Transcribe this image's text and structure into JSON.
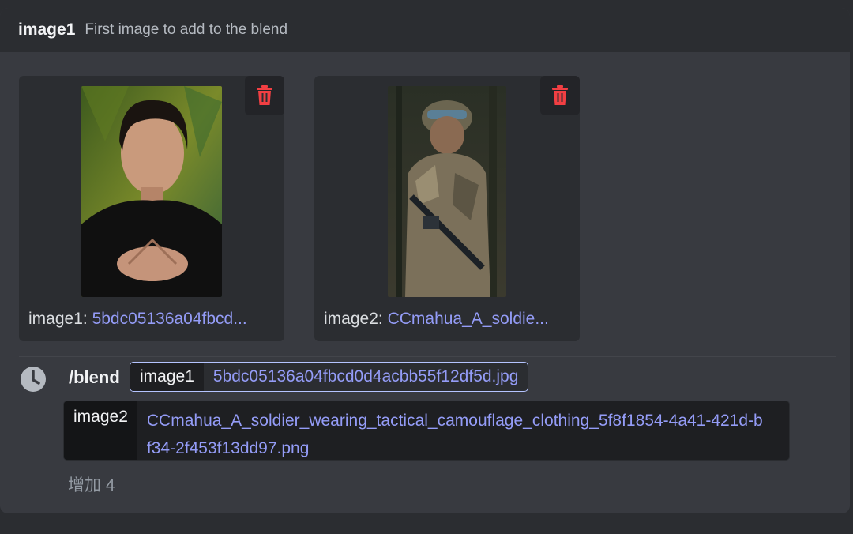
{
  "hint": {
    "name": "image1",
    "description": "First image to add to the blend"
  },
  "attachments": [
    {
      "key": "image1:",
      "value": "5bdc05136a04fbcd..."
    },
    {
      "key": "image2:",
      "value": "CCmahua_A_soldie..."
    }
  ],
  "command": {
    "name": "/blend",
    "options": [
      {
        "key": "image1",
        "value": "5bdc05136a04fbcd0d4acbb55f12df5d.jpg"
      },
      {
        "key": "image2",
        "value": "CCmahua_A_soldier_wearing_tactical_camouflage_clothing_5f8f1854-4a41-421d-bf34-2f453f13dd97.png"
      }
    ]
  },
  "more_options": "增加 4",
  "colors": {
    "accent_link": "#949cf7",
    "danger": "#f23f43",
    "panel": "#383a40"
  },
  "icons": {
    "delete": "trash-icon",
    "history": "clock-icon"
  }
}
